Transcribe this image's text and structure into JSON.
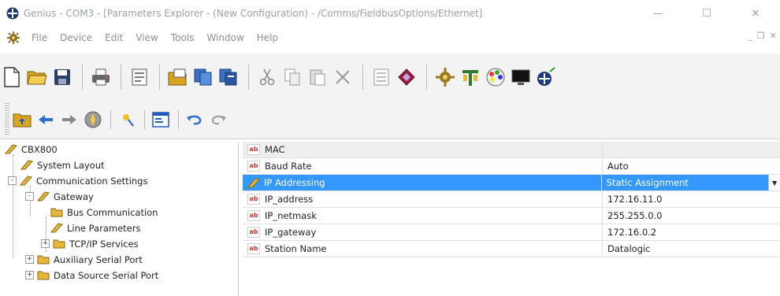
{
  "window": {
    "title": "Genius - COM3 - [Parameters Explorer - (New Configuration) - /Comms/FieldbusOptions/Ethernet]",
    "minimize": "—",
    "maximize": "☐",
    "close": "✕"
  },
  "menu": {
    "items": [
      "File",
      "Device",
      "Edit",
      "View",
      "Tools",
      "Window",
      "Help"
    ],
    "mdi_minimize": "_",
    "mdi_restore": "❐",
    "mdi_close": "✕"
  },
  "tree": {
    "root": "CBX800",
    "items": [
      {
        "label": "System Layout"
      },
      {
        "label": "Communication Settings",
        "expander": "-"
      },
      {
        "label": "Gateway",
        "expander": "-"
      },
      {
        "label": "Bus Communication"
      },
      {
        "label": "Line Parameters"
      },
      {
        "label": "TCP/IP Services",
        "expander": "+"
      },
      {
        "label": "Auxiliary Serial Port",
        "expander": "+"
      },
      {
        "label": "Data Source Serial Port",
        "expander": "+"
      }
    ]
  },
  "properties": {
    "header": "MAC",
    "rows": [
      {
        "name": "Baud Rate",
        "value": "Auto"
      },
      {
        "name": "IP Addressing",
        "value": "Static Assignment"
      },
      {
        "name": "IP_address",
        "value": "172.16.11.0"
      },
      {
        "name": "IP_netmask",
        "value": "255.255.0.0"
      },
      {
        "name": "IP_gateway",
        "value": "172.16.0.2"
      },
      {
        "name": "Station Name",
        "value": "Datalogic"
      }
    ],
    "selected_dropdown": "▼",
    "text_icon_label": "ab"
  },
  "colors": {
    "selection": "#3399ff",
    "folder": "#e8b73a"
  }
}
